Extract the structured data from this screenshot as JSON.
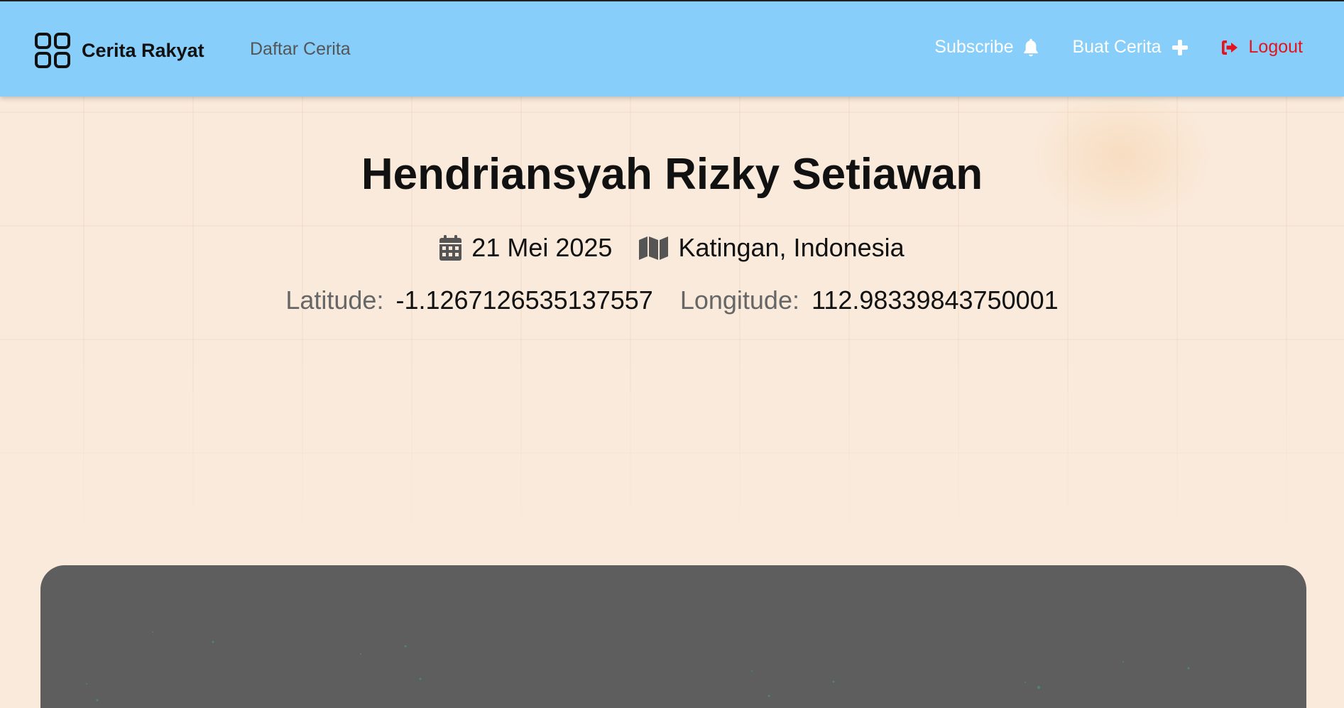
{
  "header": {
    "brand_name": "Cerita Rakyat",
    "brand_icon": "grid-icon",
    "nav_link": "Daftar Cerita",
    "subscribe_label": "Subscribe",
    "subscribe_icon": "bell-icon",
    "create_label": "Buat Cerita",
    "create_icon": "plus-icon",
    "logout_label": "Logout",
    "logout_icon": "sign-out-icon",
    "colors": {
      "background": "#87cefa",
      "logout": "#e5131d"
    }
  },
  "story": {
    "title": "Hendriansyah Rizky Setiawan",
    "date": "21 Mei 2025",
    "date_icon": "calendar-icon",
    "location": "Katingan, Indonesia",
    "location_icon": "map-icon",
    "latitude_label": "Latitude:",
    "latitude_value": "-1.1267126535137557",
    "longitude_label": "Longitude:",
    "longitude_value": "112.98339843750001"
  },
  "map": {
    "background_color": "#5e5e5e"
  }
}
